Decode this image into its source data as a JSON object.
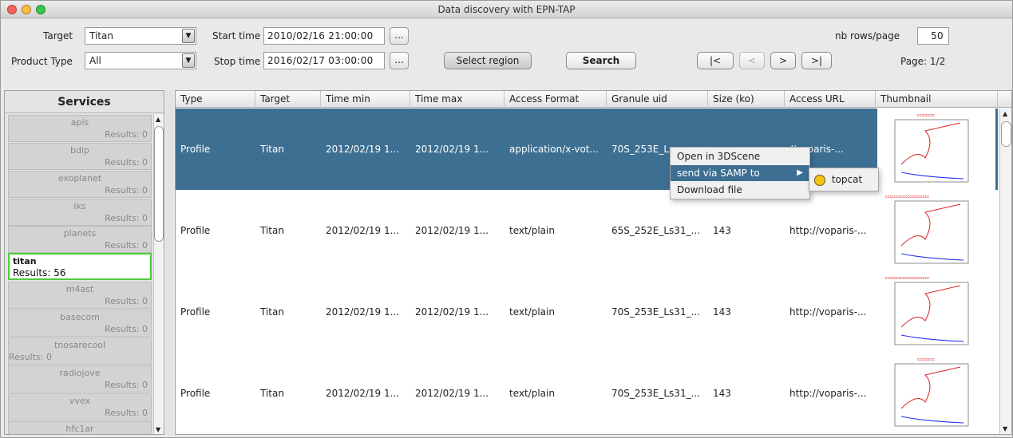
{
  "window": {
    "title": "Data discovery with EPN-TAP"
  },
  "form": {
    "target_label": "Target",
    "target_value": "Titan",
    "product_type_label": "Product Type",
    "product_type_value": "All",
    "start_time_label": "Start time",
    "start_time_value": "2010/02/16 21:00:00",
    "stop_time_label": "Stop time",
    "stop_time_value": "2016/02/17 03:00:00",
    "ellipsis": "...",
    "select_region_label": "Select region",
    "search_label": "Search",
    "nb_rows_label": "nb rows/page",
    "nb_rows_value": "50",
    "first_label": "|<",
    "prev_label": "<",
    "next_label": ">",
    "last_label": ">|",
    "page_label": "Page: 1/2"
  },
  "services": {
    "title": "Services",
    "items": [
      {
        "name": "apis",
        "results": "Results: 0"
      },
      {
        "name": "bdip",
        "results": "Results: 0"
      },
      {
        "name": "exoplanet",
        "results": "Results: 0"
      },
      {
        "name": "iks",
        "results": "Results: 0"
      },
      {
        "name": "planets",
        "results": "Results: 0"
      },
      {
        "name": "titan",
        "results": "Results: 56"
      },
      {
        "name": "m4ast",
        "results": "Results: 0"
      },
      {
        "name": "basecom",
        "results": "Results: 0"
      },
      {
        "name": "tnosarecool",
        "results": "Results: 0"
      },
      {
        "name": "radiojove",
        "results": "Results: 0"
      },
      {
        "name": "vvex",
        "results": "Results: 0"
      },
      {
        "name": "hfc1ar",
        "results": ""
      }
    ]
  },
  "table": {
    "columns": [
      "Type",
      "Target",
      "Time min",
      "Time max",
      "Access Format",
      "Granule uid",
      "Size (ko)",
      "Access URL",
      "Thumbnail"
    ],
    "rows": [
      [
        "Profile",
        "Titan",
        "2012/02/19 1...",
        "2012/02/19 1...",
        "application/x-vot...",
        "70S_253E_Ls",
        "",
        "//voparis-..."
      ],
      [
        "Profile",
        "Titan",
        "2012/02/19 1...",
        "2012/02/19 1...",
        "text/plain",
        "65S_252E_Ls31_...",
        "143",
        "http://voparis-..."
      ],
      [
        "Profile",
        "Titan",
        "2012/02/19 1...",
        "2012/02/19 1...",
        "text/plain",
        "70S_253E_Ls31_...",
        "143",
        "http://voparis-..."
      ],
      [
        "Profile",
        "Titan",
        "2012/02/19 1...",
        "2012/02/19 1...",
        "text/plain",
        "70S_253E_Ls31_...",
        "143",
        "http://voparis-..."
      ]
    ]
  },
  "context_menu": {
    "items": [
      "Open in 3DScene",
      "send via SAMP to",
      "Download file"
    ],
    "submenu_item": "topcat"
  },
  "colors": {
    "selection": "#3d6f92",
    "selected_service_border": "#4ccd3a"
  }
}
